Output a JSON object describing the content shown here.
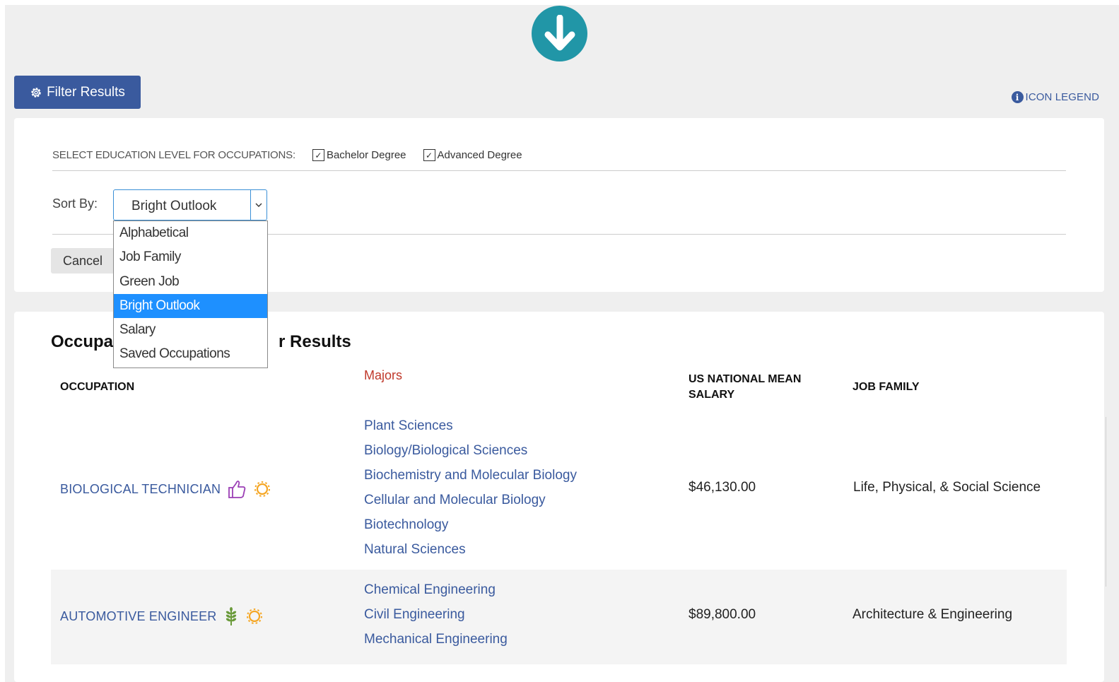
{
  "header": {
    "download_icon": "arrow-down-circle-icon"
  },
  "toolbar": {
    "filter_label": "Filter Results",
    "filter_icon": "gear-icon",
    "legend_label": "ICON LEGEND",
    "legend_icon": "info-icon"
  },
  "filters": {
    "education_label": "SELECT EDUCATION LEVEL FOR OCCUPATIONS:",
    "bachelor_label": "Bachelor Degree",
    "bachelor_checked": true,
    "advanced_label": "Advanced Degree",
    "advanced_checked": true,
    "sort_label": "Sort By:",
    "sort_value": "Bright Outlook",
    "sort_options": [
      "Alphabetical",
      "Job Family",
      "Green Job",
      "Bright Outlook",
      "Salary",
      "Saved Occupations"
    ],
    "cancel_label": "Cancel"
  },
  "results": {
    "title_start": "Occupat",
    "title_end": "r Results",
    "columns": {
      "occupation": "OCCUPATION",
      "majors": "Majors",
      "salary_line1": "US NATIONAL MEAN",
      "salary_line2": "SALARY",
      "job_family": "JOB FAMILY"
    },
    "rows": [
      {
        "occupation": "BIOLOGICAL TECHNICIAN",
        "icons": [
          "thumbs-up-icon",
          "sun-icon"
        ],
        "majors": [
          "Plant Sciences",
          "Biology/Biological Sciences",
          "Biochemistry and Molecular Biology",
          "Cellular and Molecular Biology",
          "Biotechnology",
          "Natural Sciences"
        ],
        "salary": "$46,130.00",
        "job_family": "Life, Physical, & Social Science"
      },
      {
        "occupation": "AUTOMOTIVE ENGINEER",
        "icons": [
          "wheat-icon",
          "sun-icon"
        ],
        "majors": [
          "Chemical Engineering",
          "Civil Engineering",
          "Mechanical Engineering"
        ],
        "salary": "$89,800.00",
        "job_family": "Architecture & Engineering"
      }
    ]
  },
  "colors": {
    "primary": "#3a5a9e",
    "download": "#2196a7",
    "majors_heading": "#c0392b",
    "selected_option": "#1e90ff",
    "bright_icon": "#f5a623",
    "thumbs_icon": "#9b3fb5",
    "green_icon": "#6a9a3a"
  }
}
